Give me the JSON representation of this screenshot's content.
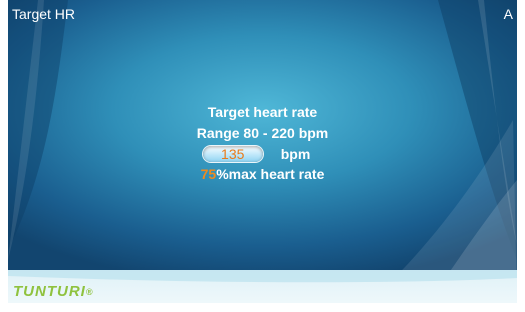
{
  "header": {
    "title": "Target HR",
    "corner_label": "A"
  },
  "main": {
    "heading": "Target heart rate",
    "range_text": "Range 80 - 220 bpm",
    "target_value": "135",
    "unit": "bpm",
    "percent_value": "75",
    "percent_suffix": "%max heart rate"
  },
  "footer": {
    "brand": "TUNTURI",
    "brand_mark": "®"
  },
  "colors": {
    "accent": "#f08a1e",
    "brand": "#8fc23e",
    "background": "#2f8fb8"
  }
}
